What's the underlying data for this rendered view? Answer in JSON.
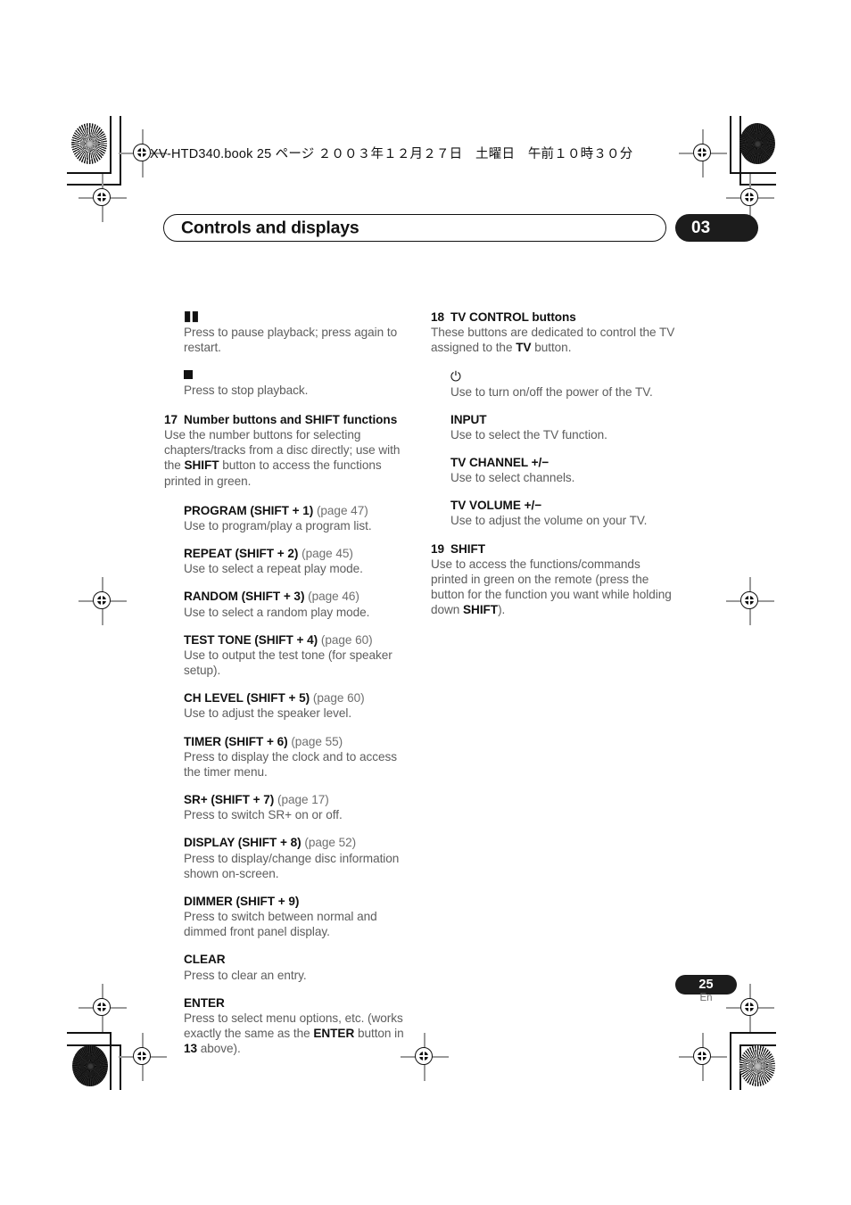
{
  "slug": "XV-HTD340.book  25 ページ  ２００３年１２月２７日　土曜日　午前１０時３０分",
  "header": {
    "title": "Controls and displays",
    "chapter_badge": "03"
  },
  "footer": {
    "page_number": "25",
    "language": "En"
  },
  "left_column": [
    {
      "symbol": "pause-icon",
      "symbol_glyph": "▮▮",
      "body": "Press to pause playback; press again to restart."
    },
    {
      "symbol": "stop-icon",
      "symbol_glyph": "■",
      "body": "Press to stop playback."
    },
    {
      "number": "17",
      "heading": "Number buttons and SHIFT functions",
      "body_pre": "Use the number buttons for selecting chapters/tracks from a disc directly; use with the ",
      "body_bold": "SHIFT",
      "body_post": " button to access the functions printed in green."
    },
    {
      "heading": "PROGRAM (SHIFT + 1)",
      "page_ref": "(page 47)",
      "body": "Use to program/play a program list."
    },
    {
      "heading": "REPEAT (SHIFT + 2)",
      "page_ref": "(page 45)",
      "body": "Use to select a repeat play mode."
    },
    {
      "heading": "RANDOM (SHIFT + 3)",
      "page_ref": "(page 46)",
      "body": "Use to select a random play mode."
    },
    {
      "heading": "TEST TONE (SHIFT + 4)",
      "page_ref": "(page 60)",
      "body": "Use to output the test tone (for speaker setup)."
    },
    {
      "heading": "CH LEVEL (SHIFT + 5)",
      "page_ref": "(page 60)",
      "body": "Use to adjust the speaker level."
    },
    {
      "heading": "TIMER (SHIFT + 6)",
      "page_ref": "(page 55)",
      "body": "Press to display the clock and to access the timer menu."
    },
    {
      "heading": "SR+ (SHIFT + 7)",
      "page_ref": "(page 17)",
      "body": "Press to switch SR+ on or off."
    },
    {
      "heading": "DISPLAY (SHIFT + 8)",
      "page_ref": "(page 52)",
      "body": "Press to display/change disc information shown on-screen."
    },
    {
      "heading": "DIMMER (SHIFT + 9)",
      "page_ref": "",
      "body": "Press to switch between normal and dimmed front panel display."
    },
    {
      "heading": "CLEAR",
      "page_ref": "",
      "body": "Press to clear an entry."
    },
    {
      "heading": "ENTER",
      "page_ref": "",
      "body_pre": "Press to select menu options, etc. (works exactly the same as the ",
      "body_bold": "ENTER",
      "body_mid": " button in ",
      "body_bold2": "13",
      "body_post": " above)."
    }
  ],
  "right_column": [
    {
      "number": "18",
      "heading": "TV CONTROL buttons",
      "body_pre": "These buttons are dedicated to control the TV assigned to the ",
      "body_bold": "TV",
      "body_post": " button."
    },
    {
      "symbol": "power-icon",
      "symbol_glyph": "⏻",
      "body": "Use to turn on/off the power of the TV."
    },
    {
      "heading": "INPUT",
      "body": "Use to select the TV function."
    },
    {
      "heading": "TV CHANNEL +/−",
      "body": "Use to select channels."
    },
    {
      "heading": "TV VOLUME +/−",
      "body": "Use to adjust the volume on your TV."
    },
    {
      "number": "19",
      "heading": "SHIFT",
      "body_pre": "Use to access the functions/commands printed in green on the remote (press the button for the function you want while holding down ",
      "body_bold": "SHIFT",
      "body_post": ")."
    }
  ]
}
